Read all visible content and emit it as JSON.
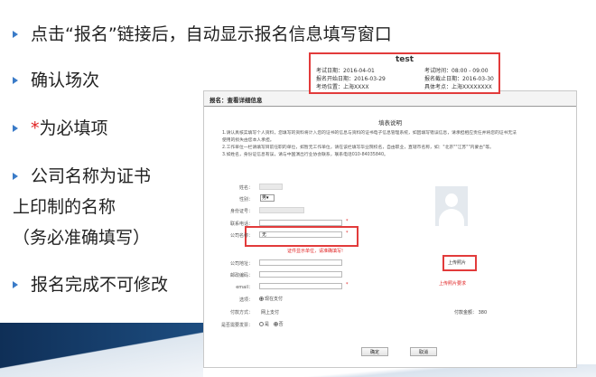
{
  "bullets": [
    {
      "text": "点击“报名”链接后，自动显示报名信息填写窗口"
    },
    {
      "text": "确认场次"
    },
    {
      "star": "*",
      "text": "为必填项"
    },
    {
      "text": "公司名称为证书",
      "line2": "上印制的名称",
      "line3": "（务必准确填写）"
    },
    {
      "text": "报名完成不可修改"
    }
  ],
  "info_box": {
    "title": "test",
    "exam_date_label": "考试日期：2016-04-01",
    "exam_time_label": "考试时间：08:00 - 09:00",
    "reg_start_label": "报名开始日期：2016-03-29",
    "reg_end_label": "报名截止日期：2016-03-30",
    "location_label": "考场位置：上海XXXX",
    "address_label": "具体考点：上海XXXXXXXX"
  },
  "form_window": {
    "header": "报名：查看详细信息",
    "fill_title": "填表说明",
    "notes": [
      "1.请认真核实填写个人资料，您填写的资料将计入您的证书的信息与资料的证书电子信息管理系统，如因填写错误信息，请承担相应责任并将您的证书无法",
      "使用的损失由您本人承担。",
      "2.工作单位一栏请填写目前任职的单位，如暂无工作单位，请在该栏填写毕业院校名，自由职业，直辖市名称，如：\"北京\"\"江苏\"\"内蒙古\"等。",
      "3.如姓名，身份证信息有误，请与中国演出行业协会联系，联系电话010-84035840。"
    ],
    "labels": {
      "name": "姓名：",
      "gender": "性别：",
      "id": "身份证号：",
      "phone": "联系电话：",
      "company": "公司名称：",
      "address": "公司地址：",
      "postcode": "邮政编码：",
      "email": "email：",
      "option": "选项：",
      "pay_method": "付款方式：",
      "invoice": "是否需要发票："
    },
    "values": {
      "gender": "男",
      "company": "无",
      "pay_method": "网上支付",
      "option": "现在支付",
      "amount": "付款金额：  380",
      "invoice_yes": "是",
      "invoice_no": "否"
    },
    "required_mark": "*",
    "company_error": "证件显示单位，请准确填写!",
    "upload_button": "上传照片",
    "upload_tip": "上传照片要求",
    "confirm_button": "确定",
    "cancel_button": "取消"
  },
  "colors": {
    "accent_blue": "#3a7bc8",
    "alert_red": "#e23b3b",
    "slide_dark": "#0f2f57"
  }
}
